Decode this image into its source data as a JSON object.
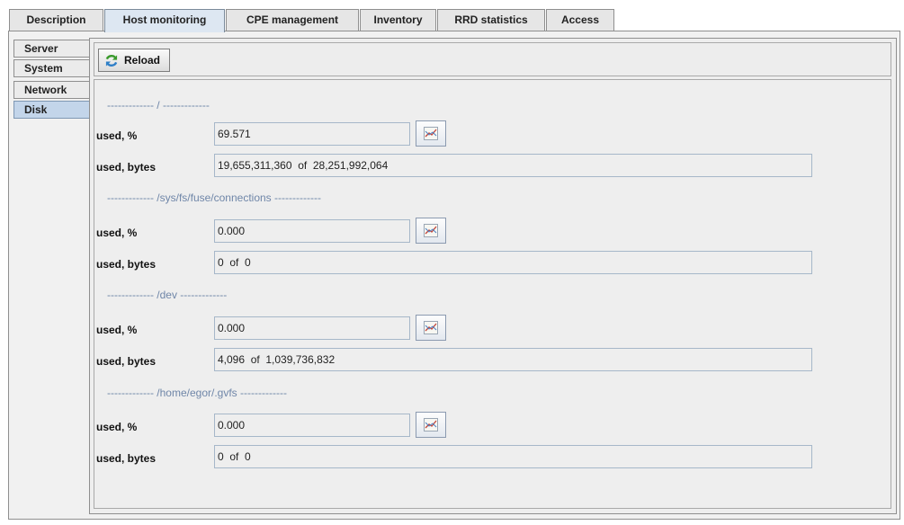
{
  "tabs": [
    "Description",
    "Host monitoring",
    "CPE management",
    "Inventory",
    "RRD statistics",
    "Access"
  ],
  "active_tab": "Host monitoring",
  "side_tabs": [
    "Server",
    "System",
    "Network",
    "Disk"
  ],
  "active_side_tab": "Disk",
  "toolbar": {
    "reload_label": "Reload"
  },
  "disks": [
    {
      "header": "------------- / -------------",
      "pct_label": "used, %",
      "pct_value": "69.571",
      "bytes_label": "used, bytes",
      "bytes_value": "19,655,311,360  of  28,251,992,064"
    },
    {
      "header": "------------- /sys/fs/fuse/connections -------------",
      "pct_label": "used, %",
      "pct_value": "0.000",
      "bytes_label": "used, bytes",
      "bytes_value": "0  of  0"
    },
    {
      "header": "------------- /dev -------------",
      "pct_label": "used, %",
      "pct_value": "0.000",
      "bytes_label": "used, bytes",
      "bytes_value": "4,096  of  1,039,736,832"
    },
    {
      "header": "------------- /home/egor/.gvfs -------------",
      "pct_label": "used, %",
      "pct_value": "0.000",
      "bytes_label": "used, bytes",
      "bytes_value": "0  of  0"
    }
  ],
  "colors": {
    "active_side_tab": "#c3d5ea",
    "header_text": "#6f86a8"
  },
  "icons": {
    "reload": "refresh-icon",
    "chart": "chart-icon"
  }
}
